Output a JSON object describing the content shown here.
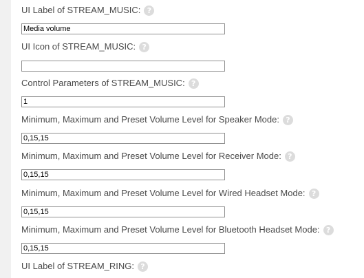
{
  "help_glyph": "?",
  "fields": [
    {
      "label": "UI Label of STREAM_MUSIC:",
      "value": "Media volume"
    },
    {
      "label": "UI Icon of STREAM_MUSIC:",
      "value": ""
    },
    {
      "label": "Control Parameters of STREAM_MUSIC:",
      "value": "1"
    },
    {
      "label": "Minimum, Maximum and Preset Volume Level for Speaker Mode:",
      "value": "0,15,15"
    },
    {
      "label": "Minimum, Maximum and Preset Volume Level for Receiver Mode:",
      "value": "0,15,15"
    },
    {
      "label": "Minimum, Maximum and Preset Volume Level for Wired Headset Mode:",
      "value": "0,15,15"
    },
    {
      "label": "Minimum, Maximum and Preset Volume Level for Bluetooth Headset Mode:",
      "value": "0,15,15"
    },
    {
      "label": "UI Label of STREAM_RING:"
    }
  ],
  "colors": {
    "label_text": "#4a4a4a",
    "help_icon": "#dcdcdc",
    "input_border": "#8f8f8f",
    "left_strip": "#f1f1f1"
  }
}
